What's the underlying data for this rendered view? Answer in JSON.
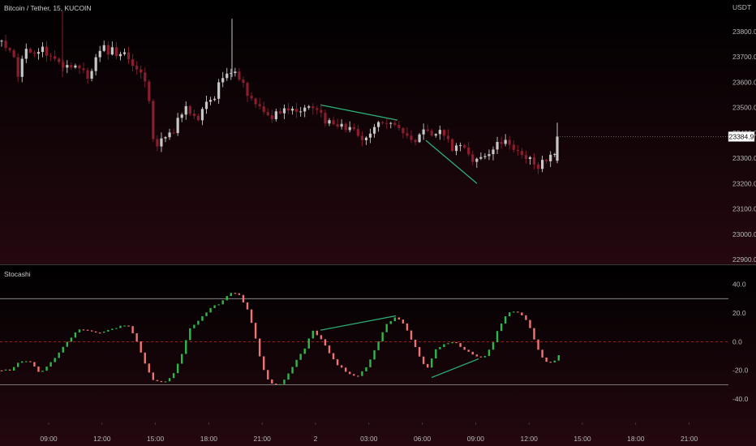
{
  "header": {
    "symbol_title": "Bitcoin / Tether, 15, KUCOIN",
    "currency": "USDT",
    "last_price": "23384.9",
    "indicator_title": "Stocashi"
  },
  "colors": {
    "bull_candle": "#c7c7c7",
    "bear_candle": "#8a1d2e",
    "osc_up": "#2eb84a",
    "osc_down": "#f07474",
    "trendline": "#2bb57a",
    "band": "#9a9a9a",
    "zero_line": "#c02b2b"
  },
  "chart_data": [
    {
      "type": "candlestick",
      "ylim": [
        22900,
        23860
      ],
      "y_ticks": [
        "23800.0",
        "23700.0",
        "23600.0",
        "23500.0",
        "23400.0",
        "23300.0",
        "23200.0",
        "23100.0",
        "23000.0",
        "22900.0"
      ],
      "x_ticks": [
        "09:00",
        "12:00",
        "15:00",
        "18:00",
        "21:00",
        "2",
        "03:00",
        "06:00",
        "09:00",
        "12:00",
        "15:00",
        "18:00",
        "21:00"
      ],
      "path": [
        [
          0,
          23760
        ],
        [
          9,
          23730
        ],
        [
          18,
          23690
        ],
        [
          24,
          23610
        ],
        [
          30,
          23750
        ],
        [
          38,
          23720
        ],
        [
          44,
          23690
        ],
        [
          50,
          23740
        ],
        [
          62,
          23700
        ],
        [
          70,
          23705
        ],
        [
          82,
          23650
        ],
        [
          96,
          23680
        ],
        [
          110,
          23610
        ],
        [
          118,
          23710
        ],
        [
          128,
          23730
        ],
        [
          140,
          23720
        ],
        [
          150,
          23710
        ],
        [
          160,
          23690
        ],
        [
          170,
          23660
        ],
        [
          182,
          23600
        ],
        [
          190,
          23330
        ],
        [
          200,
          23380
        ],
        [
          212,
          23390
        ],
        [
          222,
          23480
        ],
        [
          232,
          23500
        ],
        [
          244,
          23460
        ],
        [
          254,
          23510
        ],
        [
          264,
          23530
        ],
        [
          272,
          23610
        ],
        [
          282,
          23650
        ],
        [
          290,
          23640
        ],
        [
          300,
          23600
        ],
        [
          312,
          23510
        ],
        [
          322,
          23500
        ],
        [
          334,
          23460
        ],
        [
          346,
          23480
        ],
        [
          358,
          23480
        ],
        [
          372,
          23470
        ],
        [
          384,
          23510
        ],
        [
          398,
          23460
        ],
        [
          410,
          23420
        ],
        [
          424,
          23430
        ],
        [
          436,
          23400
        ],
        [
          448,
          23370
        ],
        [
          456,
          23390
        ],
        [
          468,
          23440
        ],
        [
          478,
          23430
        ],
        [
          490,
          23420
        ],
        [
          500,
          23400
        ],
        [
          512,
          23360
        ],
        [
          520,
          23400
        ],
        [
          530,
          23390
        ],
        [
          540,
          23420
        ],
        [
          550,
          23380
        ],
        [
          560,
          23330
        ],
        [
          570,
          23360
        ],
        [
          580,
          23290
        ],
        [
          590,
          23320
        ],
        [
          600,
          23300
        ],
        [
          612,
          23350
        ],
        [
          622,
          23360
        ],
        [
          632,
          23330
        ],
        [
          642,
          23310
        ],
        [
          652,
          23290
        ],
        [
          662,
          23270
        ],
        [
          672,
          23280
        ],
        [
          680,
          23330
        ],
        [
          688,
          23285
        ]
      ],
      "trendlines": [
        {
          "x1": 395,
          "y1": 23510,
          "x2": 490,
          "y2": 23450
        },
        {
          "x1": 525,
          "y1": 23370,
          "x2": 588,
          "y2": 23200
        }
      ]
    },
    {
      "type": "bar",
      "title": "Stocashi",
      "ylim": [
        -49,
        46
      ],
      "y_ticks": [
        "40.0",
        "20.0",
        "0.0",
        "-20.0",
        "-40.0"
      ],
      "bands": [
        30,
        -30
      ],
      "path": [
        [
          0,
          -20
        ],
        [
          14,
          -20
        ],
        [
          26,
          -13
        ],
        [
          36,
          -14
        ],
        [
          50,
          -22
        ],
        [
          64,
          -14
        ],
        [
          80,
          -2
        ],
        [
          96,
          9
        ],
        [
          110,
          8
        ],
        [
          125,
          6
        ],
        [
          140,
          9
        ],
        [
          150,
          12
        ],
        [
          160,
          10
        ],
        [
          170,
          -2
        ],
        [
          180,
          -17
        ],
        [
          190,
          -28
        ],
        [
          202,
          -28
        ],
        [
          212,
          -25
        ],
        [
          222,
          -12
        ],
        [
          234,
          9
        ],
        [
          246,
          15
        ],
        [
          258,
          23
        ],
        [
          272,
          27
        ],
        [
          284,
          34
        ],
        [
          294,
          33
        ],
        [
          304,
          24
        ],
        [
          312,
          10
        ],
        [
          320,
          -10
        ],
        [
          328,
          -25
        ],
        [
          336,
          -30
        ],
        [
          346,
          -30
        ],
        [
          356,
          -22
        ],
        [
          366,
          -12
        ],
        [
          376,
          -4
        ],
        [
          386,
          8
        ],
        [
          396,
          2
        ],
        [
          406,
          -8
        ],
        [
          416,
          -16
        ],
        [
          428,
          -22
        ],
        [
          440,
          -25
        ],
        [
          452,
          -18
        ],
        [
          464,
          -3
        ],
        [
          476,
          12
        ],
        [
          486,
          17
        ],
        [
          496,
          14
        ],
        [
          506,
          3
        ],
        [
          516,
          -9
        ],
        [
          526,
          -20
        ],
        [
          538,
          -5
        ],
        [
          548,
          -1
        ],
        [
          560,
          0
        ],
        [
          572,
          -5
        ],
        [
          584,
          -10
        ],
        [
          596,
          -11
        ],
        [
          606,
          -3
        ],
        [
          616,
          11
        ],
        [
          626,
          20
        ],
        [
          636,
          21
        ],
        [
          646,
          18
        ],
        [
          656,
          6
        ],
        [
          666,
          -10
        ],
        [
          676,
          -15
        ],
        [
          684,
          -13
        ],
        [
          690,
          -8
        ]
      ],
      "trendlines": [
        {
          "x1": 395,
          "y1": 8,
          "x2": 488,
          "y2": 18
        },
        {
          "x1": 532,
          "y1": -25,
          "x2": 590,
          "y2": -12
        }
      ]
    }
  ]
}
